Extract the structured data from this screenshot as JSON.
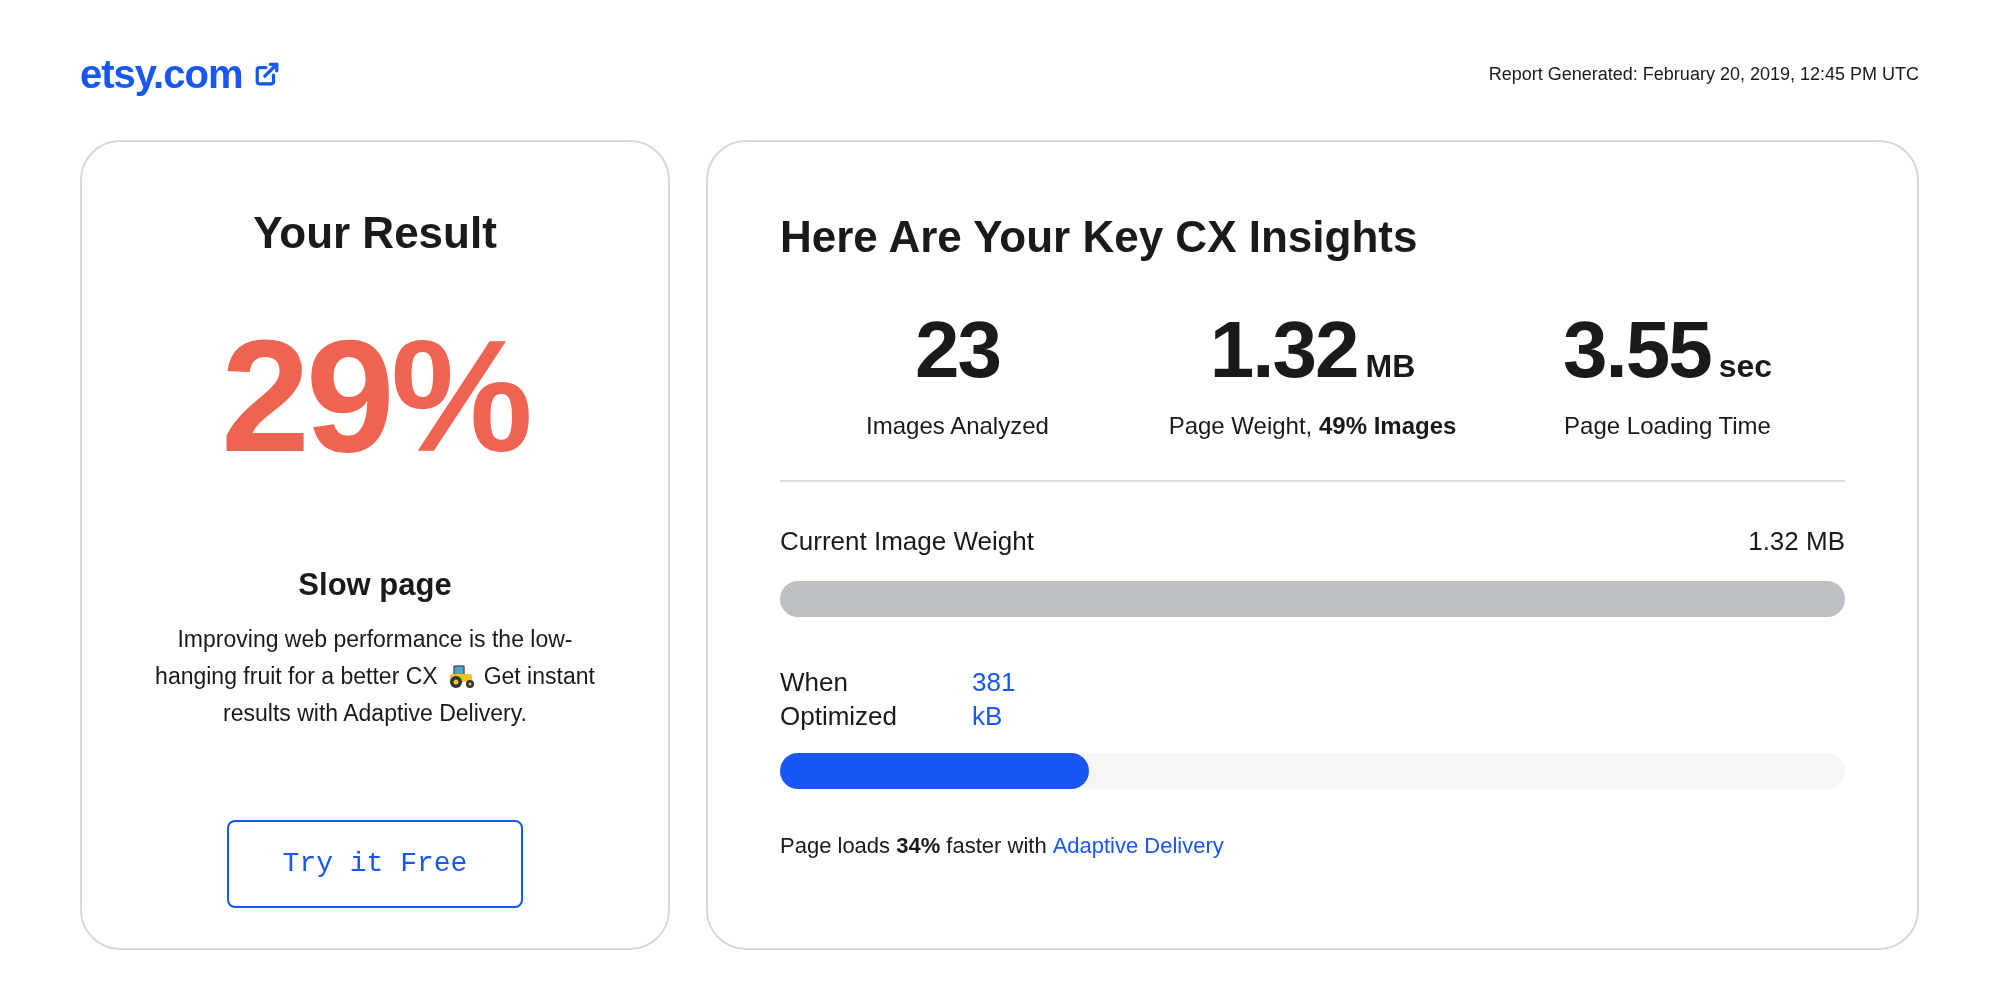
{
  "header": {
    "site": "etsy.com",
    "report": "Report Generated: February 20, 2019, 12:45 PM UTC"
  },
  "result": {
    "title": "Your Result",
    "score": "29%",
    "verdict": "Slow page",
    "description_lines": [
      {
        "text": "Improving web performance is the low-"
      },
      {
        "text": "hanging fruit for a better CX",
        "kind": "with_icon",
        "text_after": "Get instant"
      },
      {
        "text": "results with Adaptive Delivery."
      }
    ],
    "button": "Try it Free"
  },
  "insights": {
    "title": "Here Are Your Key CX Insights",
    "metrics": [
      {
        "value": "23",
        "label": "Images Analyzed"
      },
      {
        "value": "1.32",
        "unit": "MB",
        "label": "Page Weight, **49% Images**"
      },
      {
        "value": "3.55",
        "unit": "sec",
        "label": "Page Loading Time"
      }
    ],
    "bars": [
      {
        "kind": "current",
        "label": "Current Image Weight",
        "value": "1.32 MB"
      },
      {
        "kind": "optimized",
        "label": "When Optimized",
        "value": "381 kB",
        "level": 0.29
      }
    ],
    "footer": {
      "text": "Page loads **34%** faster with",
      "link": "Adaptive Delivery"
    }
  }
}
